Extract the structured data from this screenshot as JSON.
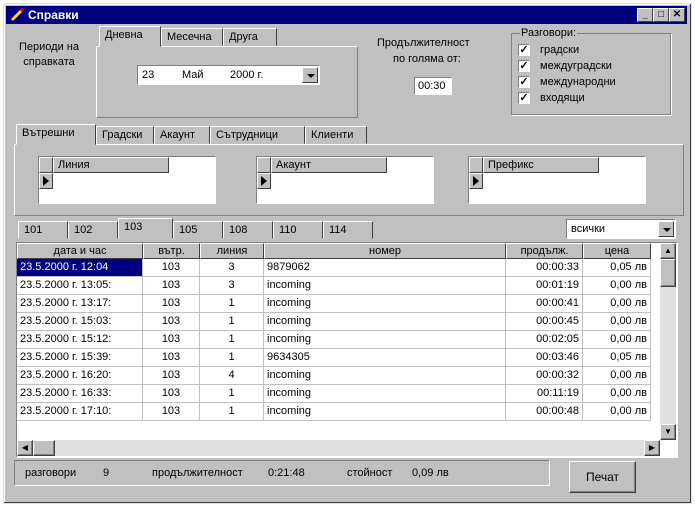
{
  "window": {
    "title": "Справки"
  },
  "periods": {
    "label": "Периоди на справката",
    "tabs": [
      "Дневна",
      "Месечна",
      "Друга"
    ],
    "active_tab": 0,
    "date": {
      "day": "23",
      "month": "Май",
      "year": "2000 г."
    }
  },
  "duration": {
    "label_line1": "Продължителност",
    "label_line2": "по голяма от:",
    "value": "00:30"
  },
  "calls": {
    "title": "Разговори:",
    "options": [
      {
        "label": "градски",
        "checked": true
      },
      {
        "label": "междуградски",
        "checked": true
      },
      {
        "label": "международни",
        "checked": true
      },
      {
        "label": "входящи",
        "checked": true
      }
    ]
  },
  "filter_tabs": [
    "Вътрешни",
    "Градски",
    "Акаунт",
    "Сътрудници",
    "Клиенти"
  ],
  "filter_active": 0,
  "subgrids": [
    {
      "header": "Линия"
    },
    {
      "header": "Акаунт"
    },
    {
      "header": "Префикс"
    }
  ],
  "ext_tabs": [
    "101",
    "102",
    "103",
    "105",
    "108",
    "110",
    "114"
  ],
  "ext_active": 2,
  "filter_select": "всички",
  "table": {
    "columns": [
      "дата и час",
      "вътр.",
      "линия",
      "номер",
      "продълж.",
      "цена"
    ],
    "rows": [
      [
        "23.5.2000 г. 12:04",
        "103",
        "3",
        "9879062",
        "00:00:33",
        "0,05 лв"
      ],
      [
        "23.5.2000 г. 13:05:",
        "103",
        "3",
        "incoming",
        "00:01:19",
        "0,00 лв"
      ],
      [
        "23.5.2000 г. 13:17:",
        "103",
        "1",
        "incoming",
        "00:00:41",
        "0,00 лв"
      ],
      [
        "23.5.2000 г. 15:03:",
        "103",
        "1",
        "incoming",
        "00:00:45",
        "0,00 лв"
      ],
      [
        "23.5.2000 г. 15:12:",
        "103",
        "1",
        "incoming",
        "00:02:05",
        "0,00 лв"
      ],
      [
        "23.5.2000 г. 15:39:",
        "103",
        "1",
        "9634305",
        "00:03:46",
        "0,05 лв"
      ],
      [
        "23.5.2000 г. 16:20:",
        "103",
        "4",
        "incoming",
        "00:00:32",
        "0,00 лв"
      ],
      [
        "23.5.2000 г. 16:33:",
        "103",
        "1",
        "incoming",
        "00:11:19",
        "0,00 лв"
      ],
      [
        "23.5.2000 г. 17:10:",
        "103",
        "1",
        "incoming",
        "00:00:48",
        "0,00 лв"
      ]
    ],
    "selected_row": 0
  },
  "status": {
    "calls_label": "разговори",
    "calls_value": "9",
    "duration_label": "продължителност",
    "duration_value": "0:21:48",
    "cost_label": "стойност",
    "cost_value": "0,09 лв"
  },
  "print_button": "Печат",
  "colors": {
    "title_bg": "#000080",
    "selection": "#000080",
    "face": "#c0c0c0"
  }
}
